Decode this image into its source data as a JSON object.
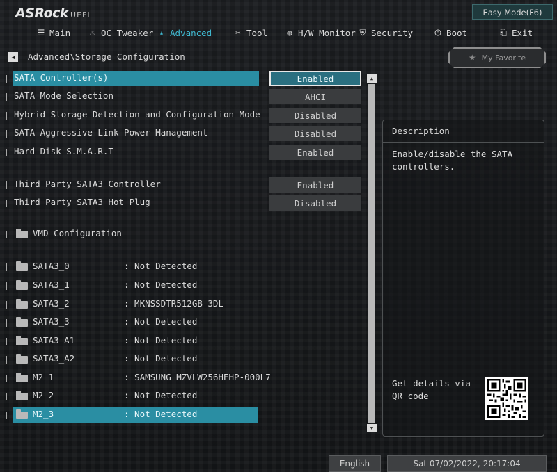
{
  "brand": {
    "name": "ASRock",
    "suffix": "UEFI"
  },
  "header": {
    "easy_mode_label": "Easy Mode(F6)"
  },
  "nav": [
    {
      "label": "Main",
      "icon": "menu-icon"
    },
    {
      "label": "OC Tweaker",
      "icon": "flame-icon"
    },
    {
      "label": "Advanced",
      "icon": "star-icon",
      "active": true
    },
    {
      "label": "Tool",
      "icon": "tools-icon"
    },
    {
      "label": "H/W Monitor",
      "icon": "monitor-icon"
    },
    {
      "label": "Security",
      "icon": "shield-icon"
    },
    {
      "label": "Boot",
      "icon": "power-icon"
    },
    {
      "label": "Exit",
      "icon": "exit-icon"
    }
  ],
  "breadcrumb": "Advanced\\Storage Configuration",
  "favorite": {
    "label": "My Favorite",
    "icon": "star-icon"
  },
  "settings": [
    {
      "label": "SATA Controller(s)",
      "value": "Enabled",
      "selected": true
    },
    {
      "label": "SATA Mode Selection",
      "value": "AHCI"
    },
    {
      "label": "Hybrid Storage Detection and Configuration Mode",
      "value": "Disabled"
    },
    {
      "label": "SATA Aggressive Link Power Management",
      "value": "Disabled"
    },
    {
      "label": "Hard Disk S.M.A.R.T",
      "value": "Enabled"
    },
    {
      "label": "Third Party SATA3 Controller",
      "value": "Enabled"
    },
    {
      "label": "Third Party SATA3 Hot Plug",
      "value": "Disabled"
    }
  ],
  "vmd": {
    "label": "VMD Configuration"
  },
  "devices": [
    {
      "port": "SATA3_0",
      "detail": ": Not Detected"
    },
    {
      "port": "SATA3_1",
      "detail": ": Not Detected"
    },
    {
      "port": "SATA3_2",
      "detail": ": MKNSSDTR512GB-3DL"
    },
    {
      "port": "SATA3_3",
      "detail": ": Not Detected"
    },
    {
      "port": "SATA3_A1",
      "detail": ": Not Detected"
    },
    {
      "port": "SATA3_A2",
      "detail": ": Not Detected"
    },
    {
      "port": "M2_1",
      "detail": ": SAMSUNG MZVLW256HEHP-000L7"
    },
    {
      "port": "M2_2",
      "detail": ": Not Detected"
    },
    {
      "port": "M2_3",
      "detail": ": Not Detected",
      "selected": true
    }
  ],
  "description": {
    "title": "Description",
    "text": "Enable/disable the SATA controllers.",
    "qr_text": "Get details via QR code"
  },
  "footer": {
    "language": "English",
    "datetime": "Sat 07/02/2022, 20:17:04"
  },
  "colors": {
    "accent": "#2a8ea3",
    "nav_active": "#3fb8d0",
    "value_button": "#3a3c3e"
  }
}
